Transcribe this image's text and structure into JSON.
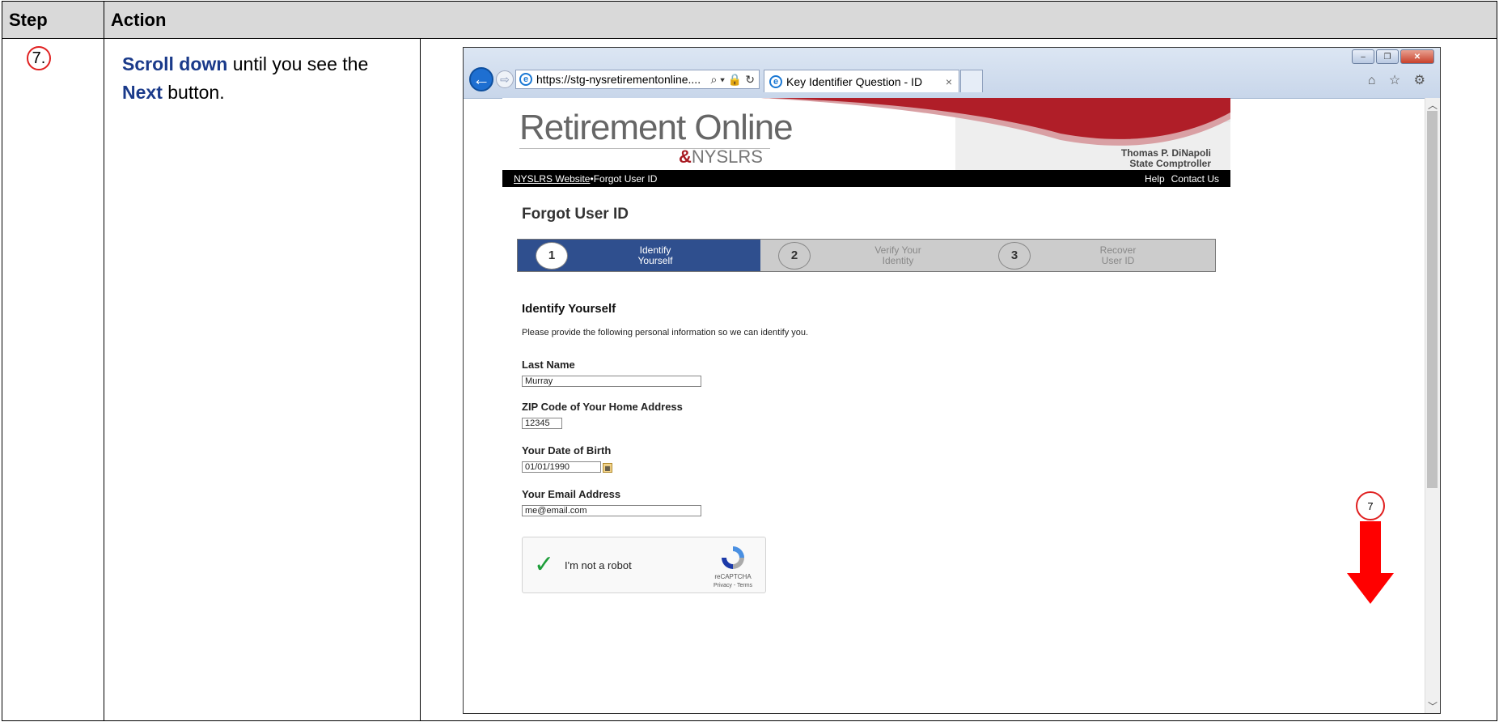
{
  "table": {
    "header_step": "Step",
    "header_action": "Action",
    "step_number": "7.",
    "action_emph1": "Scroll down",
    "action_text1": " until you see the ",
    "action_emph2": "Next",
    "action_text2": " button."
  },
  "browser": {
    "url": "https://stg-nysretirementonline....",
    "url_icons": "⌕ ▾ 🔒 ↻",
    "tab_title": "Key Identifier Question - ID",
    "tab_close": "×",
    "toolbar_icons": "⌂ ☆ ⚙",
    "win_min": "–",
    "win_max": "❐",
    "win_close": "✕"
  },
  "site": {
    "brand": "Retirement Online",
    "brand_amp": "&",
    "brand_sub": "NYSLRS",
    "comptroller_name": "Thomas P. DiNapoli",
    "comptroller_title": "State Comptroller",
    "nav_link": "NYSLRS Website",
    "nav_sep": " • ",
    "nav_current": "Forgot User ID",
    "nav_help": "Help",
    "nav_contact": "Contact Us"
  },
  "form": {
    "page_title": "Forgot User ID",
    "steps": [
      {
        "num": "1",
        "line1": "Identify",
        "line2": "Yourself",
        "state": "active"
      },
      {
        "num": "2",
        "line1": "Verify Your",
        "line2": "Identity",
        "state": "inactive"
      },
      {
        "num": "3",
        "line1": "Recover",
        "line2": "User ID",
        "state": "inactive"
      }
    ],
    "section_title": "Identify Yourself",
    "intro": "Please provide the following personal information so we can identify you.",
    "last_name_label": "Last Name",
    "last_name_value": "Murray",
    "zip_label": "ZIP Code of Your Home Address",
    "zip_value": "12345",
    "dob_label": "Your Date of Birth",
    "dob_value": "01/01/1990",
    "email_label": "Your Email Address",
    "email_value": "me@email.com",
    "captcha_label": "I'm not a robot",
    "captcha_brand": "reCAPTCHA",
    "captcha_links": "Privacy - Terms"
  },
  "annotation": {
    "callout_number": "7",
    "arrow_color": "#ff0000"
  }
}
